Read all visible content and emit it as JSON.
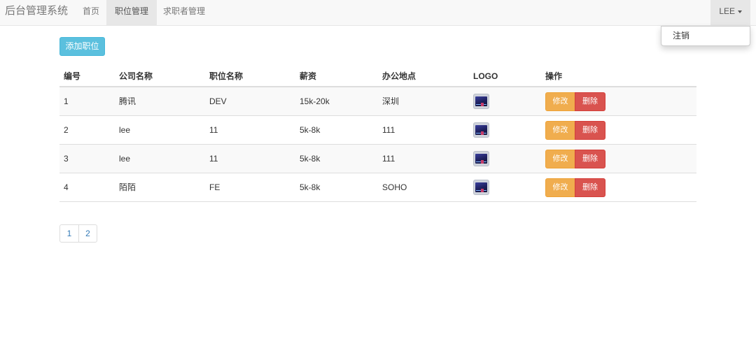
{
  "navbar": {
    "brand": "后台管理系统",
    "items": [
      {
        "label": "首页"
      },
      {
        "label": "职位管理"
      },
      {
        "label": "求职者管理"
      }
    ],
    "user": {
      "name": "LEE",
      "menu": [
        {
          "label": "注销"
        }
      ]
    }
  },
  "toolbar": {
    "add_label": "添加职位"
  },
  "table": {
    "headers": [
      "编号",
      "公司名称",
      "职位名称",
      "薪资",
      "办公地点",
      "LOGO",
      "操作"
    ],
    "rows": [
      {
        "id": "1",
        "company": "腾讯",
        "position": "DEV",
        "salary": "15k-20k",
        "location": "深圳"
      },
      {
        "id": "2",
        "company": "lee",
        "position": "11",
        "salary": "5k-8k",
        "location": "111"
      },
      {
        "id": "3",
        "company": "lee",
        "position": "11",
        "salary": "5k-8k",
        "location": "111"
      },
      {
        "id": "4",
        "company": "陌陌",
        "position": "FE",
        "salary": "5k-8k",
        "location": "SOHO"
      }
    ],
    "actions": {
      "edit": "修改",
      "delete": "删除"
    }
  },
  "pagination": {
    "pages": [
      "1",
      "2"
    ]
  },
  "colors": {
    "info": "#5bc0de",
    "warning": "#f0ad4e",
    "danger": "#d9534f",
    "link": "#337ab7"
  }
}
